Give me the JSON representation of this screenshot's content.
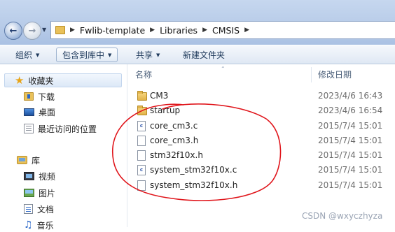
{
  "address": {
    "crumbs": [
      "Fwlib-template",
      "Libraries",
      "CMSIS"
    ]
  },
  "toolbar": {
    "organize": "组织",
    "include_library": "包含到库中",
    "share": "共享",
    "new_folder": "新建文件夹"
  },
  "sidebar": {
    "favorites": "收藏夹",
    "downloads": "下载",
    "desktop": "桌面",
    "recent": "最近访问的位置",
    "libraries": "库",
    "videos": "视频",
    "pictures": "图片",
    "documents": "文档",
    "music": "音乐"
  },
  "columns": {
    "name": "名称",
    "modified": "修改日期"
  },
  "files": [
    {
      "name": "CM3",
      "date": "2023/4/6 16:43",
      "type": "folder"
    },
    {
      "name": "startup",
      "date": "2023/4/6 16:54",
      "type": "folder"
    },
    {
      "name": "core_cm3.c",
      "date": "2015/7/4 15:01",
      "type": "c-file"
    },
    {
      "name": "core_cm3.h",
      "date": "2015/7/4 15:01",
      "type": "h-file"
    },
    {
      "name": "stm32f10x.h",
      "date": "2015/7/4 15:01",
      "type": "h-file"
    },
    {
      "name": "system_stm32f10x.c",
      "date": "2015/7/4 15:01",
      "type": "c-file"
    },
    {
      "name": "system_stm32f10x.h",
      "date": "2015/7/4 15:01",
      "type": "h-file"
    }
  ],
  "watermark": "CSDN @wxyczhyza",
  "colors": {
    "annotation": "#e0151b",
    "selection": "#dce8f7"
  }
}
